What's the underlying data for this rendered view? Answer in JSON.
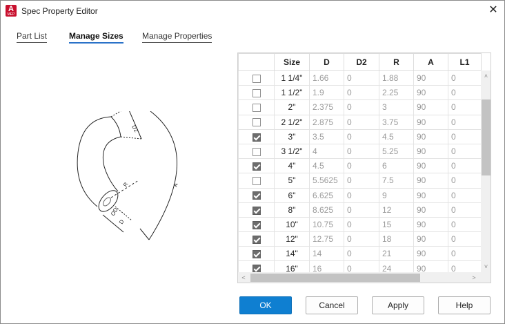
{
  "window": {
    "title": "Spec Property Editor",
    "icon_letter": "A",
    "icon_sub": "MEP",
    "close_glyph": "✕"
  },
  "tabs": [
    {
      "label": "Part List",
      "active": false
    },
    {
      "label": "Manage Sizes",
      "active": true
    },
    {
      "label": "Manage Properties",
      "active": false
    }
  ],
  "figure_labels": {
    "d2": "D2",
    "r": "R",
    "a": "A",
    "od": "OD",
    "d": "D"
  },
  "grid": {
    "columns": [
      "",
      "Size",
      "D",
      "D2",
      "R",
      "A",
      "L1"
    ],
    "rows": [
      {
        "checked": false,
        "size": "1 1/4\"",
        "D": "1.66",
        "D2": "0",
        "R": "1.88",
        "A": "90",
        "L1": "0"
      },
      {
        "checked": false,
        "size": "1 1/2\"",
        "D": "1.9",
        "D2": "0",
        "R": "2.25",
        "A": "90",
        "L1": "0"
      },
      {
        "checked": false,
        "size": "2\"",
        "D": "2.375",
        "D2": "0",
        "R": "3",
        "A": "90",
        "L1": "0"
      },
      {
        "checked": false,
        "size": "2 1/2\"",
        "D": "2.875",
        "D2": "0",
        "R": "3.75",
        "A": "90",
        "L1": "0"
      },
      {
        "checked": true,
        "size": "3\"",
        "D": "3.5",
        "D2": "0",
        "R": "4.5",
        "A": "90",
        "L1": "0"
      },
      {
        "checked": false,
        "size": "3 1/2\"",
        "D": "4",
        "D2": "0",
        "R": "5.25",
        "A": "90",
        "L1": "0"
      },
      {
        "checked": true,
        "size": "4\"",
        "D": "4.5",
        "D2": "0",
        "R": "6",
        "A": "90",
        "L1": "0"
      },
      {
        "checked": false,
        "size": "5\"",
        "D": "5.5625",
        "D2": "0",
        "R": "7.5",
        "A": "90",
        "L1": "0"
      },
      {
        "checked": true,
        "size": "6\"",
        "D": "6.625",
        "D2": "0",
        "R": "9",
        "A": "90",
        "L1": "0"
      },
      {
        "checked": true,
        "size": "8\"",
        "D": "8.625",
        "D2": "0",
        "R": "12",
        "A": "90",
        "L1": "0"
      },
      {
        "checked": true,
        "size": "10\"",
        "D": "10.75",
        "D2": "0",
        "R": "15",
        "A": "90",
        "L1": "0"
      },
      {
        "checked": true,
        "size": "12\"",
        "D": "12.75",
        "D2": "0",
        "R": "18",
        "A": "90",
        "L1": "0"
      },
      {
        "checked": true,
        "size": "14\"",
        "D": "14",
        "D2": "0",
        "R": "21",
        "A": "90",
        "L1": "0"
      },
      {
        "checked": true,
        "size": "16\"",
        "D": "16",
        "D2": "0",
        "R": "24",
        "A": "90",
        "L1": "0"
      }
    ]
  },
  "scroll_glyphs": {
    "up": "˄",
    "down": "˅",
    "left": "<",
    "right": ">"
  },
  "buttons": {
    "ok": "OK",
    "cancel": "Cancel",
    "apply": "Apply",
    "help": "Help"
  }
}
